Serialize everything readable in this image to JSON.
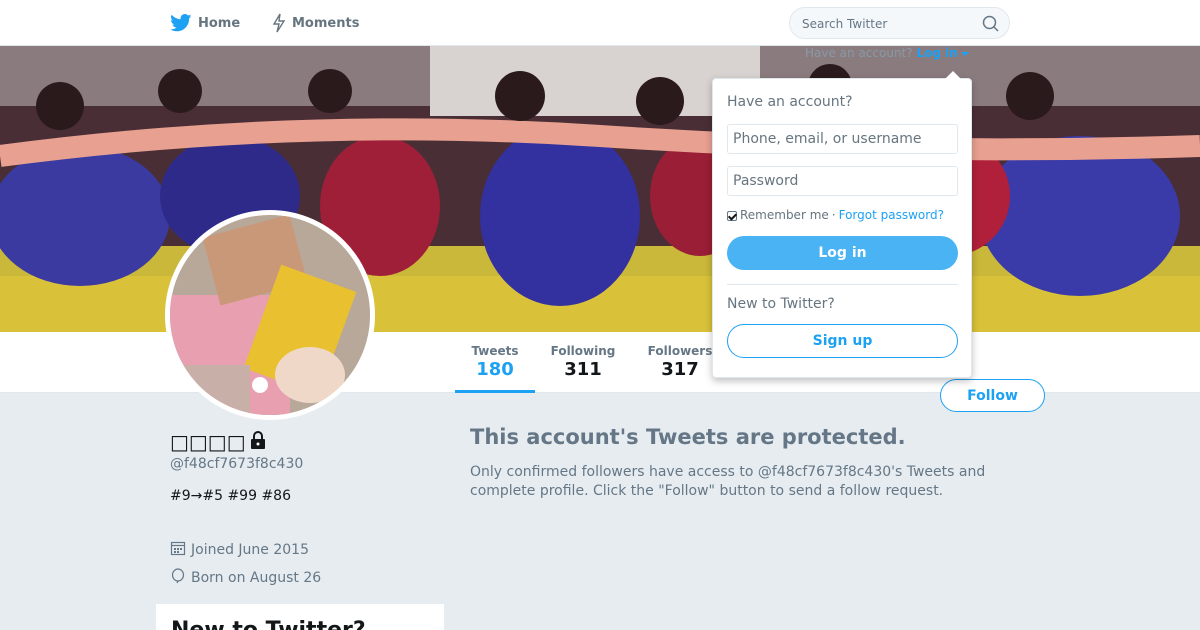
{
  "nav": {
    "home_label": "Home",
    "moments_label": "Moments",
    "search_placeholder": "Search Twitter",
    "brand_color": "#1da1f2"
  },
  "login_hint": {
    "text": "Have an account?",
    "link": "Log in"
  },
  "profile_nav": {
    "stats": [
      {
        "label": "Tweets",
        "value": "180"
      },
      {
        "label": "Following",
        "value": "311"
      },
      {
        "label": "Followers",
        "value": "317"
      }
    ],
    "follow_label": "Follow"
  },
  "profile": {
    "name": "□□□□",
    "handle": "@f48cf7673f8c430",
    "bio": "#9→#5 #99 #86",
    "joined": "Joined June 2015",
    "born": "Born on August 26",
    "side_card_title": "New to Twitter?"
  },
  "protected": {
    "title": "This account's Tweets are protected.",
    "text": "Only confirmed followers have access to @f48cf7673f8c430's Tweets and complete profile. Click the \"Follow\" button to send a follow request."
  },
  "login_dropdown": {
    "heading": "Have an account?",
    "username_placeholder": "Phone, email, or username",
    "password_placeholder": "Password",
    "remember_label": "Remember me",
    "separator": "·",
    "forgot_label": "Forgot password?",
    "login_label": "Log in",
    "new_heading": "New to Twitter?",
    "signup_label": "Sign up"
  }
}
